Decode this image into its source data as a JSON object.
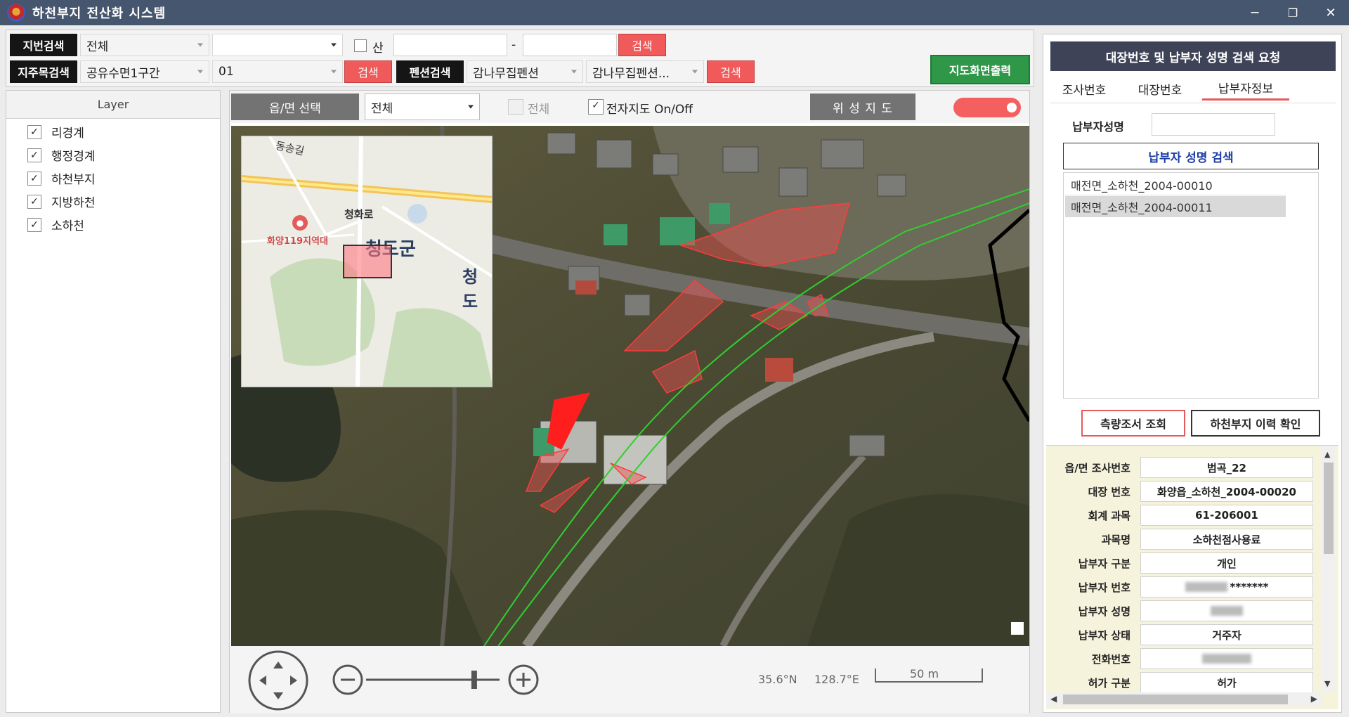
{
  "window": {
    "title": "하천부지 전산화 시스템",
    "minimize": "─",
    "restore": "❐",
    "close": "✕"
  },
  "search": {
    "jibun_label": "지번검색",
    "jibun_select": "전체",
    "jibun_select2": "",
    "san_label": "산",
    "dash": "-",
    "search_btn": "검색",
    "jijumok_label": "지주목검색",
    "jijumok_select": "공유수면1구간",
    "jijumok_num": "01",
    "pension_label": "펜션검색",
    "pension_select1": "감나무집펜션",
    "pension_select2": "감나무집펜션...",
    "print_btn": "지도화면출력"
  },
  "layers": {
    "header": "Layer",
    "items": [
      {
        "label": "리경계",
        "checked": "✓"
      },
      {
        "label": "행정경계",
        "checked": "✓"
      },
      {
        "label": "하천부지",
        "checked": "✓"
      },
      {
        "label": "지방하천",
        "checked": "✓"
      },
      {
        "label": "소하천",
        "checked": "✓"
      }
    ]
  },
  "map": {
    "eup_btn": "읍/면 선택",
    "eup_select": "전체",
    "all_label": "전체",
    "emap_label": "전자지도 On/Off",
    "emap_checked": "✓",
    "satellite_btn": "위 성 지 도",
    "minimap": {
      "road1": "동송길",
      "road2": "청화로",
      "poi": "화양119지역대",
      "county": "청도군",
      "county2": "청도"
    },
    "coord_lat": "35.6°N",
    "coord_lon": "128.7°E",
    "scale": "50 m",
    "zoom_level": 0.81
  },
  "right": {
    "header": "대장번호 및 납부자 성명 검색 요청",
    "tabs": [
      "조사번호",
      "대장번호",
      "납부자정보"
    ],
    "payer_label": "납부자성명",
    "payer_search_btn": "납부자 성명 검색",
    "results": [
      "매전면_소하천_2004-00010",
      "매전면_소하천_2004-00011"
    ],
    "survey_btn": "측량조서 조회",
    "history_btn": "하천부지 이력 확인",
    "info": [
      {
        "k": "읍/면 조사번호",
        "v": "범곡_22"
      },
      {
        "k": "대장 번호",
        "v": "화양읍_소하천_2004-00020"
      },
      {
        "k": "회계 과목",
        "v": "61-206001"
      },
      {
        "k": "과목명",
        "v": "소하천점사용료"
      },
      {
        "k": "납부자 구분",
        "v": "개인"
      },
      {
        "k": "납부자 번호",
        "v": "*******"
      },
      {
        "k": "납부자 성명",
        "v": ""
      },
      {
        "k": "납부자 상태",
        "v": "거주자"
      },
      {
        "k": "전화번호",
        "v": ""
      },
      {
        "k": "허가 구분",
        "v": "허가"
      }
    ]
  }
}
